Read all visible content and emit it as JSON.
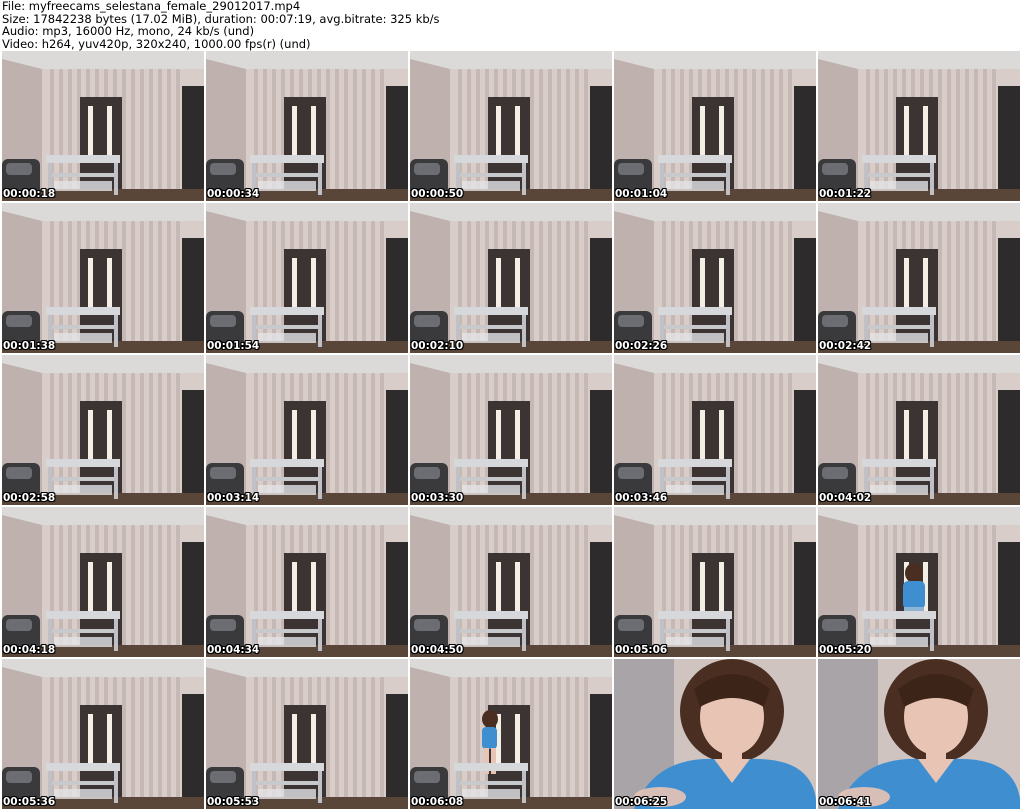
{
  "header": {
    "file_line": "File: myfreecams_selestana_female_29012017.mp4",
    "size_line": "Size: 17842238 bytes (17.02 MiB), duration: 00:07:19, avg.bitrate: 325 kb/s",
    "audio_line": "Audio: mp3, 16000 Hz, mono, 24 kb/s (und)",
    "video_line": "Video: h264, yuv420p, 320x240, 1000.00 fps(r) (und)"
  },
  "thumbnails": [
    {
      "time": "00:00:18",
      "scene": "room"
    },
    {
      "time": "00:00:34",
      "scene": "room"
    },
    {
      "time": "00:00:50",
      "scene": "room"
    },
    {
      "time": "00:01:04",
      "scene": "room"
    },
    {
      "time": "00:01:22",
      "scene": "room"
    },
    {
      "time": "00:01:38",
      "scene": "room"
    },
    {
      "time": "00:01:54",
      "scene": "room"
    },
    {
      "time": "00:02:10",
      "scene": "room"
    },
    {
      "time": "00:02:26",
      "scene": "room"
    },
    {
      "time": "00:02:42",
      "scene": "room"
    },
    {
      "time": "00:02:58",
      "scene": "room"
    },
    {
      "time": "00:03:14",
      "scene": "room"
    },
    {
      "time": "00:03:30",
      "scene": "room"
    },
    {
      "time": "00:03:46",
      "scene": "room"
    },
    {
      "time": "00:04:02",
      "scene": "room"
    },
    {
      "time": "00:04:18",
      "scene": "room"
    },
    {
      "time": "00:04:34",
      "scene": "room"
    },
    {
      "time": "00:04:50",
      "scene": "room"
    },
    {
      "time": "00:05:06",
      "scene": "room"
    },
    {
      "time": "00:05:20",
      "scene": "room-person-back"
    },
    {
      "time": "00:05:36",
      "scene": "room"
    },
    {
      "time": "00:05:53",
      "scene": "room"
    },
    {
      "time": "00:06:08",
      "scene": "room-person-door"
    },
    {
      "time": "00:06:25",
      "scene": "closeup"
    },
    {
      "time": "00:06:41",
      "scene": "closeup"
    }
  ],
  "colors": {
    "wall_light": "#d9cdc9",
    "wall_stripe": "#b7a7a4",
    "ceiling": "#dcdad8",
    "door": "#3b3432",
    "door_glass": "#f4efe4",
    "floor": "#5a4638",
    "table": "#d7d8dc",
    "shirt": "#3f8fd0",
    "hair": "#4a2e22",
    "skin": "#e8c4b4"
  }
}
